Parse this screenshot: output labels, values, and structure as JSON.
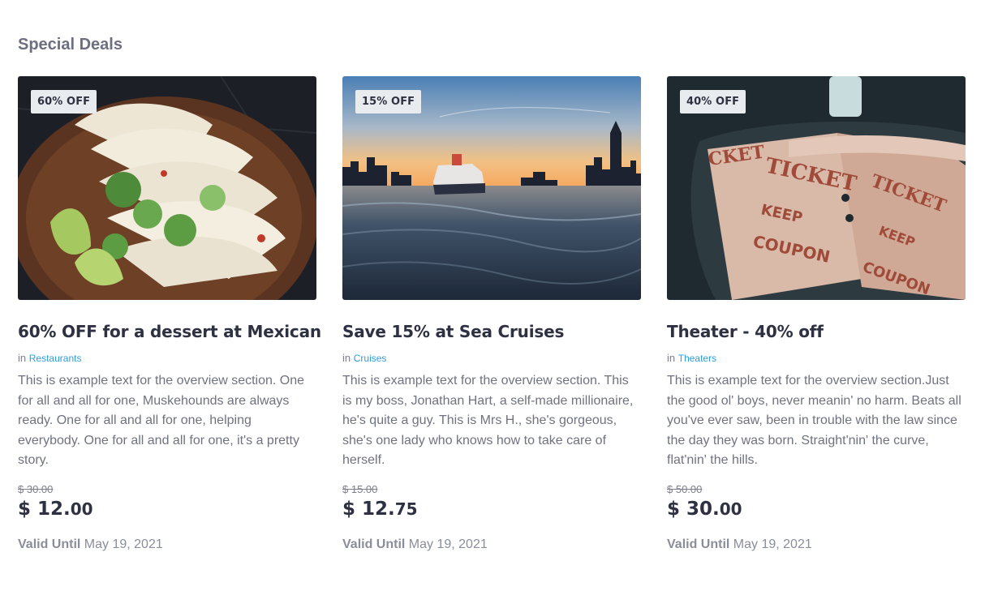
{
  "section": {
    "title": "Special Deals"
  },
  "deals": [
    {
      "badge": "60% OFF",
      "title": "60% OFF for a dessert at Mexican",
      "category_prefix": "in",
      "category": "Restaurants",
      "description": "This is example text for the overview section. One for all and all for one, Muskehounds are always ready. One for all and all for one, helping everybody. One for all and all for one, it's a pretty story.",
      "old_price": "$ 30.00",
      "price_main": "$ 12.",
      "price_cents": "00",
      "valid_label": "Valid Until",
      "valid_date": "May 19, 2021"
    },
    {
      "badge": "15% OFF",
      "title": "Save 15% at Sea Cruises",
      "category_prefix": "in",
      "category": "Cruises",
      "description": "This is example text for the overview section. This is my boss, Jonathan Hart, a self-made millionaire, he's quite a guy. This is Mrs H., she's gorgeous, she's one lady who knows how to take care of herself.",
      "old_price": "$ 15.00",
      "price_main": "$ 12.",
      "price_cents": "75",
      "valid_label": "Valid Until",
      "valid_date": "May 19, 2021"
    },
    {
      "badge": "40% OFF",
      "title": "Theater - 40% off",
      "category_prefix": "in",
      "category": "Theaters",
      "description": "This is example text for the overview section.Just the good ol' boys, never meanin' no harm. Beats all you've ever saw, been in trouble with the law since the day they was born. Straight'nin' the curve, flat'nin' the hills.",
      "old_price": "$ 50.00",
      "price_main": "$ 30.",
      "price_cents": "00",
      "valid_label": "Valid Until",
      "valid_date": "May 19, 2021"
    }
  ],
  "colors": {
    "title": "#2d3142",
    "muted": "#6f7380",
    "link": "#2b9ede",
    "badge_bg": "#e9ecef"
  }
}
